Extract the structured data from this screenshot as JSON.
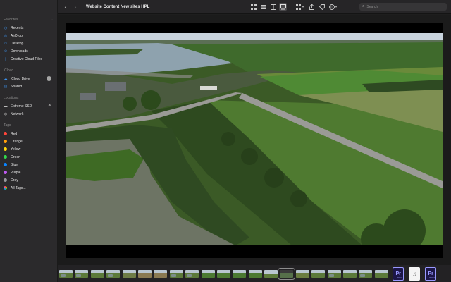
{
  "window": {
    "title": "Website Content New sites HPL"
  },
  "sidebar": {
    "sections": [
      {
        "label": "Favorites",
        "items": [
          {
            "label": "Recents",
            "icon": "clock-icon"
          },
          {
            "label": "AirDrop",
            "icon": "airdrop-icon"
          },
          {
            "label": "Desktop",
            "icon": "desktop-icon"
          },
          {
            "label": "Downloads",
            "icon": "downloads-icon"
          },
          {
            "label": "Creative Cloud Files",
            "icon": "document-icon"
          }
        ]
      },
      {
        "label": "iCloud",
        "items": [
          {
            "label": "iCloud Drive",
            "icon": "cloud-icon"
          },
          {
            "label": "Shared",
            "icon": "shared-folder-icon"
          }
        ]
      },
      {
        "label": "Locations",
        "items": [
          {
            "label": "Extreme SSD",
            "icon": "drive-icon"
          },
          {
            "label": "Network",
            "icon": "globe-icon"
          }
        ]
      },
      {
        "label": "Tags",
        "items": [
          {
            "label": "Red",
            "color": "#ff453a"
          },
          {
            "label": "Orange",
            "color": "#ff9f0a"
          },
          {
            "label": "Yellow",
            "color": "#ffd60a"
          },
          {
            "label": "Green",
            "color": "#32d74b"
          },
          {
            "label": "Blue",
            "color": "#0a84ff"
          },
          {
            "label": "Purple",
            "color": "#bf5af2"
          },
          {
            "label": "Gray",
            "color": "#98989d"
          },
          {
            "label": "All Tags...",
            "icon": "all-tags-icon"
          }
        ]
      }
    ]
  },
  "toolbar": {
    "search_placeholder": "Search",
    "pr_label": "Pr",
    "pr_sub": "PROJ"
  },
  "colors": {
    "accent": "#3b8fe8",
    "sidebar_bg": "#2b2a2c",
    "window_bg": "#1e1e1e"
  },
  "filmstrip": {
    "thumbnail_count": 22,
    "selected_index": 15
  }
}
